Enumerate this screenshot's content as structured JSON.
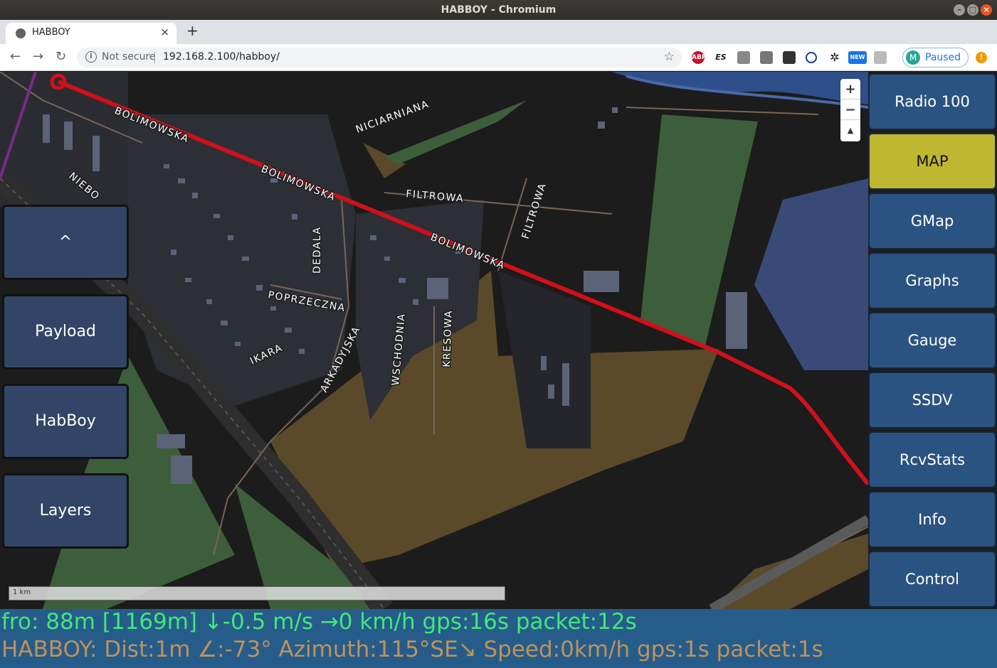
{
  "window": {
    "title": "HABBOY - Chromium"
  },
  "browser": {
    "tab_title": "HABBOY",
    "tab_close": "×",
    "new_tab": "+",
    "security": "Not secure",
    "url": "192.168.2.100/habboy/",
    "profile_initial": "M",
    "profile_status": "Paused",
    "extensions": [
      "ABP",
      "ES",
      "",
      "",
      "",
      "",
      "",
      "NEW",
      ""
    ]
  },
  "map": {
    "streets": [
      "BOLIMOWSKA",
      "BOLIMOWSKA",
      "BOLIMOWSKA",
      "NICIARNIANA",
      "FILTROWA",
      "FILTROWA",
      "DEDALA",
      "POPRZECZNA",
      "IKARA",
      "ARKADYJSKA",
      "WSCHODNIA",
      "KRESOWA",
      "NIEBO"
    ],
    "zoom_in": "+",
    "zoom_out": "−",
    "reset_bearing": "▲",
    "scale_label": "1 km",
    "track_color": "#d0101a"
  },
  "left_panel": {
    "buttons": [
      "^",
      "Payload",
      "HabBoy",
      "Layers"
    ]
  },
  "right_panel": {
    "buttons": [
      "Radio 100",
      "MAP",
      "GMap",
      "Graphs",
      "Gauge",
      "SSDV",
      "RcvStats",
      "Info",
      "Control"
    ],
    "active": "MAP",
    "active_color": "#bfb730"
  },
  "status": {
    "line1": "fro: 88m [1169m] ↓-0.5 m/s →0 km/h gps:16s packet:12s",
    "line2": "HABBOY: Dist:1m ∠:-73° Azimuth:115°SE↘ Speed:0km/h gps:1s packet:1s",
    "line1_color": "#40e87a",
    "line2_color": "#c0925a"
  }
}
